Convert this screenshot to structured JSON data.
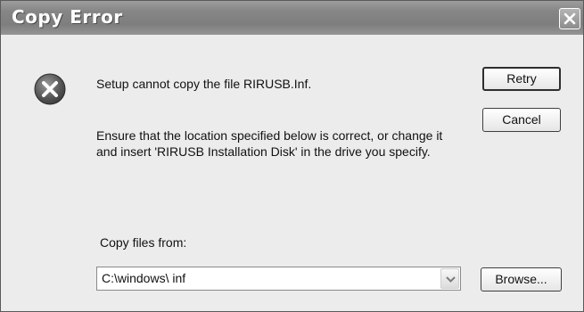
{
  "window": {
    "title": "Copy Error"
  },
  "icons": {
    "error": "error-icon",
    "close": "close-icon",
    "dropdown": "chevron-down-icon"
  },
  "message": {
    "line1": "Setup cannot copy the file RIRUSB.Inf.",
    "line2": "Ensure that the location specified below is correct, or change it and insert 'RIRUSB Installation Disk' in the drive you specify."
  },
  "buttons": {
    "retry": "Retry",
    "cancel": "Cancel",
    "browse": "Browse..."
  },
  "copy_from": {
    "label": "Copy files from:",
    "value": "C:\\windows\\ inf"
  }
}
